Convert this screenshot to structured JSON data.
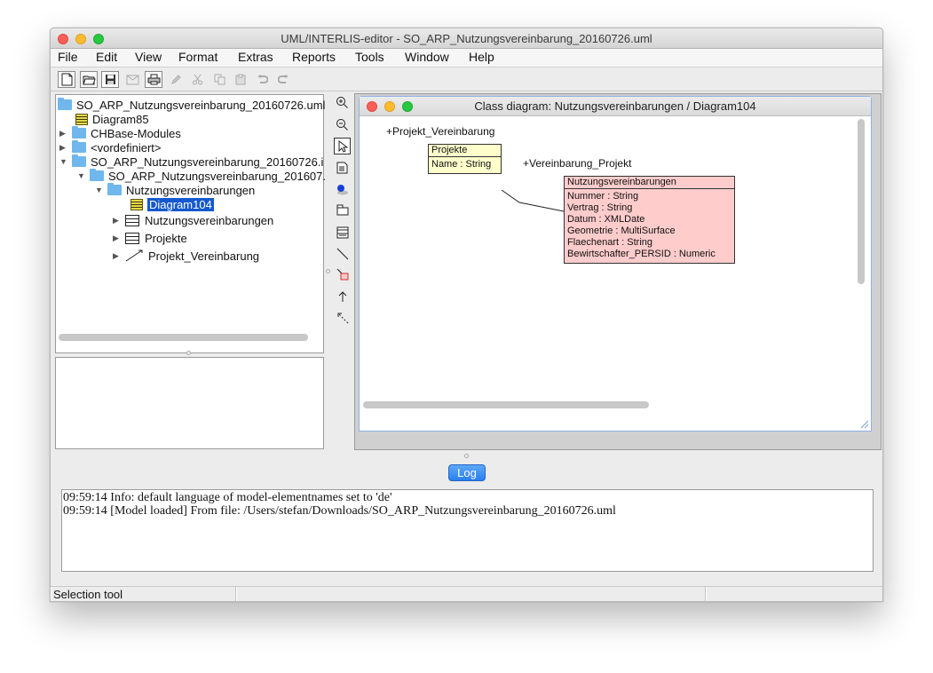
{
  "window": {
    "title": "UML/INTERLIS-editor - SO_ARP_Nutzungsvereinbarung_20160726.uml",
    "colors": {
      "close": "#fc5f57",
      "minimize": "#fdbc2e",
      "maximize": "#28c840"
    }
  },
  "menu": [
    "File",
    "Edit",
    "View",
    "Format",
    "Extras",
    "Reports",
    "Tools",
    "Window",
    "Help"
  ],
  "toolbar": {
    "buttons": [
      "new-file-icon",
      "open-folder-icon",
      "save-icon",
      "mail-icon",
      "print-icon",
      "pen-icon",
      "cut-icon",
      "copy-icon",
      "paste-icon",
      "undo-icon",
      "redo-icon"
    ]
  },
  "tree": {
    "root": "SO_ARP_Nutzungsvereinbarung_20160726.uml",
    "diagram85": "Diagram85",
    "chbase": "CHBase-Modules",
    "vordefiniert": "<vordefiniert>",
    "model_file": "SO_ARP_Nutzungsvereinbarung_20160726.i",
    "model": "SO_ARP_Nutzungsvereinbarung_201607.",
    "topic": "Nutzungsvereinbarungen",
    "diagram104": "Diagram104",
    "class1": "Nutzungsvereinbarungen",
    "class2": "Projekte",
    "assoc": "Projekt_Vereinbarung"
  },
  "diagram": {
    "title": "Class diagram: Nutzungsvereinbarungen / Diagram104",
    "projekte": {
      "name": "Projekte",
      "attributes": [
        "Name : String"
      ],
      "color": "#ffffcc",
      "role": "+Projekt_Vereinbarung"
    },
    "nutzung": {
      "name": "Nutzungsvereinbarungen",
      "attributes": [
        "Nummer : String",
        "Vertrag : String",
        "Datum : XMLDate",
        "Geometrie : MultiSurface",
        "Flaechenart : String",
        "Bewirtschafter_PERSID : Numeric"
      ],
      "color": "#ffcccc",
      "role": "+Vereinbarung_Projekt"
    }
  },
  "log": {
    "tab_label": "Log",
    "lines": [
      "09:59:14 Info: default language of model-elementnames set to 'de'",
      "09:59:14 [Model loaded] From file: /Users/stefan/Downloads/SO_ARP_Nutzungsvereinbarung_20160726.uml"
    ]
  },
  "status": {
    "text": "Selection tool"
  }
}
